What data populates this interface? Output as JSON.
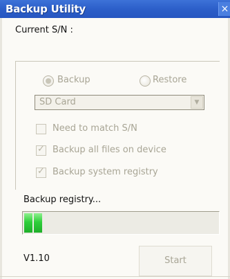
{
  "window": {
    "title": "Backup Utility",
    "close_glyph": "×"
  },
  "serial": {
    "label": "Current S/N :"
  },
  "mode": {
    "backup_label": "Backup",
    "restore_label": "Restore",
    "selected": "Backup"
  },
  "storage": {
    "selected": "SD Card"
  },
  "options": [
    {
      "label": "Need to match S/N",
      "checked": false
    },
    {
      "label": "Backup all files on device",
      "checked": true
    },
    {
      "label": "Backup system registry",
      "checked": true
    }
  ],
  "status": {
    "text": "Backup registry..."
  },
  "progress": {
    "fraction": 0.07,
    "color": "#2fcf3a"
  },
  "footer": {
    "version": "V1.10",
    "start_label": "Start"
  },
  "colors": {
    "title_bar": "#2c5fc9",
    "disabled_text": "#a8a595"
  }
}
